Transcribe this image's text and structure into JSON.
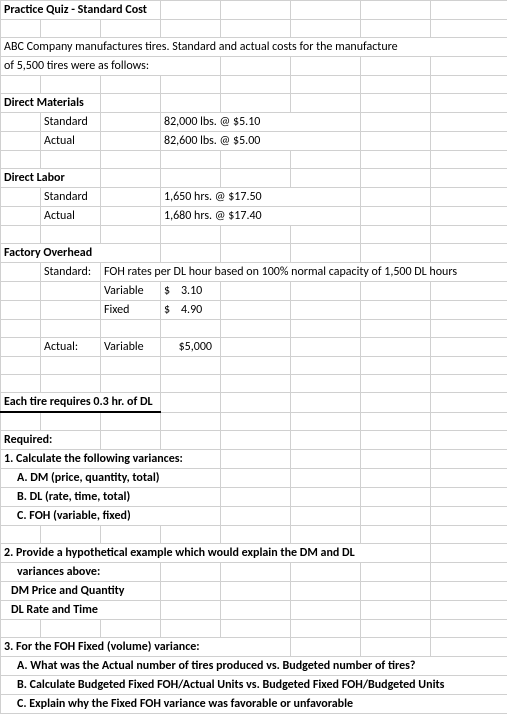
{
  "title": "Practice Quiz - Standard Cost",
  "intro1": "ABC Company manufactures tires.  Standard and actual costs for the manufacture",
  "intro2": "of 5,500 tires were as follows:",
  "dm": {
    "header": "Direct Materials",
    "std_label": "Standard",
    "std_val": "82,000 lbs. @ $5.10",
    "act_label": "Actual",
    "act_val": "82,600 lbs. @ $5.00"
  },
  "dl": {
    "header": "Direct Labor",
    "std_label": "Standard",
    "std_val": "1,650 hrs. @ $17.50",
    "act_label": "Actual",
    "act_val": "1,680 hrs. @ $17.40"
  },
  "foh": {
    "header": "Factory Overhead",
    "std_label": "Standard:",
    "std_desc": "FOH rates per DL hour based on 100% normal capacity of 1,500 DL hours",
    "var_label": "Variable",
    "var_sym": "$",
    "var_val": "3.10",
    "fix_label": "Fixed",
    "fix_sym": "$",
    "fix_val": "4.90",
    "act_label": "Actual:",
    "act_var_label": "Variable",
    "act_var_val": "$5,000"
  },
  "each": "Each tire requires 0.3 hr. of DL",
  "req": {
    "header": "Required:",
    "q1": "1. Calculate the following variances:",
    "q1a": "A. DM (price, quantity, total)",
    "q1b": "B. DL (rate, time, total)",
    "q1c": "C. FOH (variable, fixed)",
    "q2": "2. Provide a hypothetical example which would explain the DM and DL",
    "q2b": "variances above:",
    "q2c": "DM Price and Quantity",
    "q2d": "DL Rate and Time",
    "q3": "3.  For the FOH Fixed (volume) variance:",
    "q3a": "A.  What was the Actual number of tires produced vs. Budgeted number of tires?",
    "q3b": "B.  Calculate Budgeted Fixed FOH/Actual Units vs. Budgeted Fixed FOH/Budgeted Units",
    "q3c": "C.  Explain why the Fixed FOH variance was favorable or unfavorable"
  }
}
